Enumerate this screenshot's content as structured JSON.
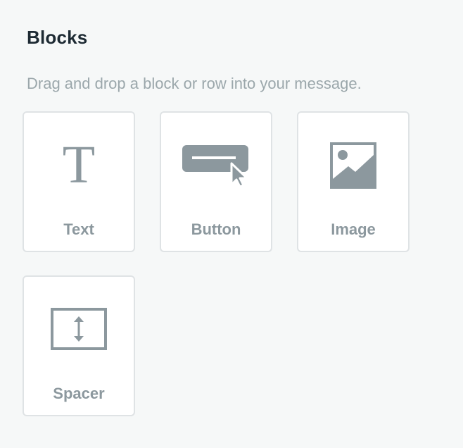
{
  "panel": {
    "title": "Blocks",
    "subtitle": "Drag and drop a block or row into your message."
  },
  "blocks": [
    {
      "label": "Text",
      "icon": "text-icon",
      "glyph": "T"
    },
    {
      "label": "Button",
      "icon": "button-icon"
    },
    {
      "label": "Image",
      "icon": "image-icon"
    },
    {
      "label": "Spacer",
      "icon": "spacer-icon"
    }
  ],
  "colors": {
    "background": "#f6f8f8",
    "tile_background": "#ffffff",
    "tile_border": "#dfe3e5",
    "icon": "#8c989e",
    "title": "#1d2a33",
    "subtitle": "#9ba7ab"
  }
}
